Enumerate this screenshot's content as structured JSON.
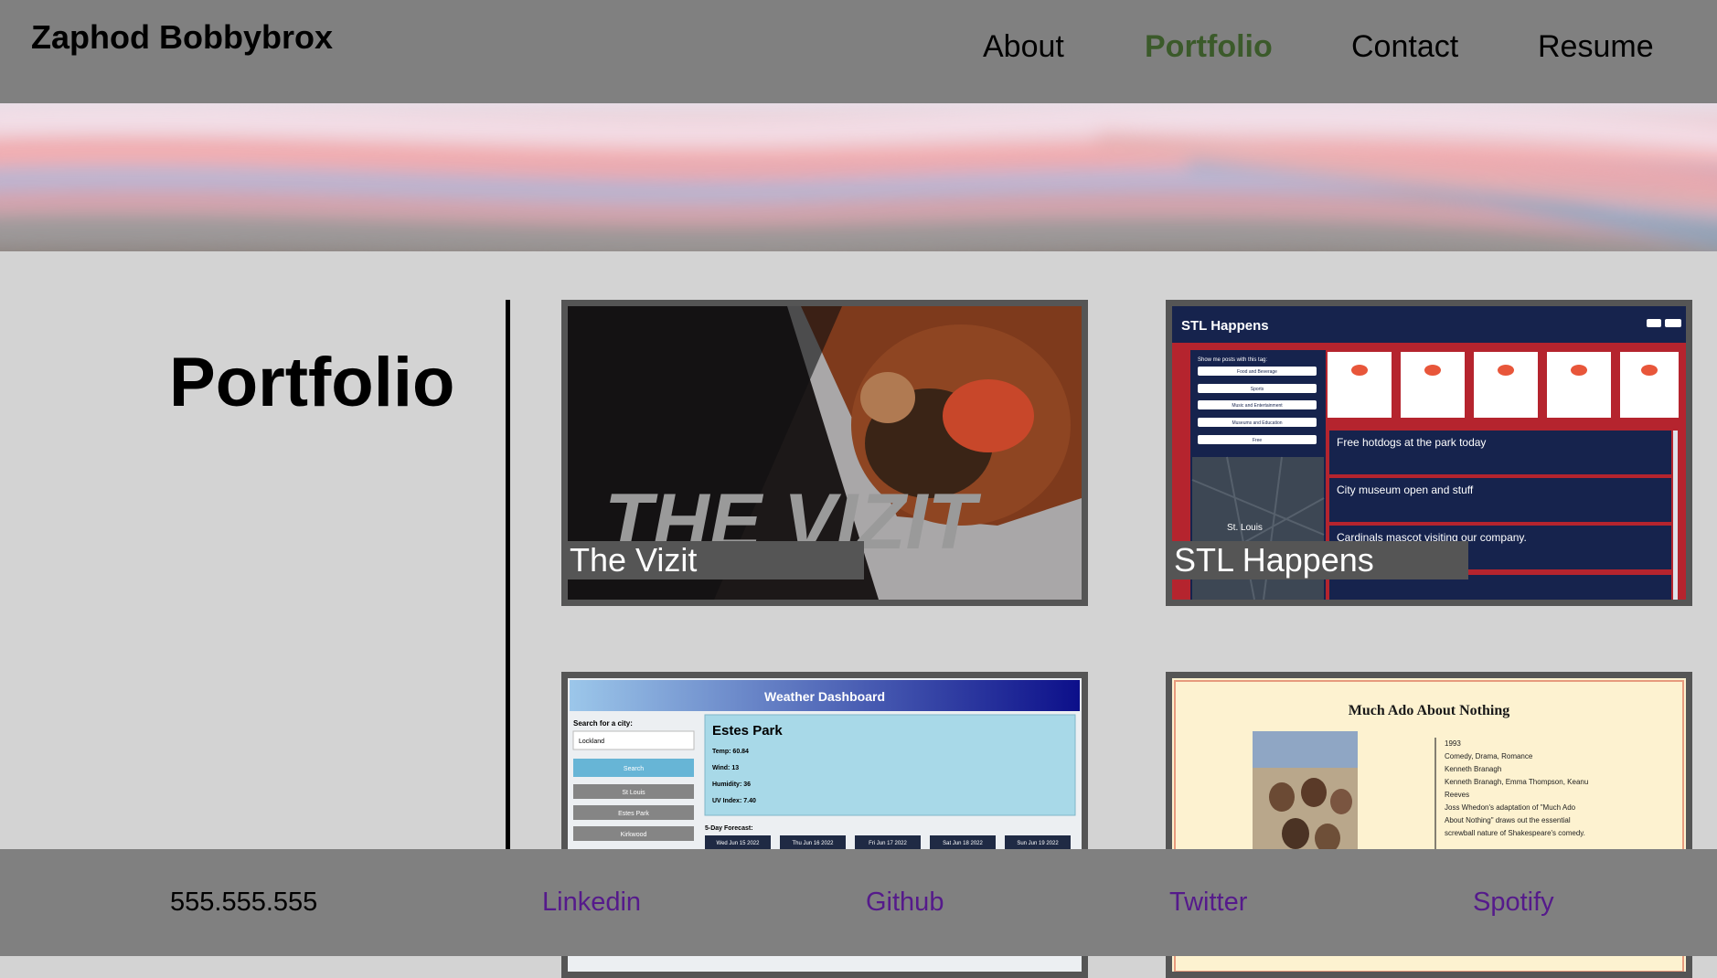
{
  "header": {
    "brand": "Zaphod Bobbybrox",
    "nav": [
      {
        "label": "About"
      },
      {
        "label": "Portfolio",
        "active": true
      },
      {
        "label": "Contact"
      },
      {
        "label": "Resume"
      }
    ]
  },
  "main": {
    "title": "Portfolio",
    "projects": [
      {
        "label": "The Vizit",
        "thumb_text": "THE VIZIT"
      },
      {
        "label": "STL Happens",
        "thumb": {
          "app_title": "STL Happens",
          "tag_prompt": "Show me posts with this tag:",
          "tags": [
            "Food and Beverage",
            "Sports",
            "Music and Entertainment",
            "Museums and Education",
            "Free"
          ],
          "map_city": "St. Louis",
          "posts": [
            "Free hotdogs at the park today",
            "City museum open and stuff",
            "Cardinals mascot visiting our company."
          ]
        }
      },
      {
        "label": "",
        "thumb": {
          "app_title": "Weather Dashboard",
          "search_label": "Search for a city:",
          "search_value": "Lockland",
          "search_button": "Search",
          "history": [
            "St Louis",
            "Estes Park",
            "Kirkwood"
          ],
          "city": "Estes Park",
          "stats": [
            "Temp: 60.84",
            "Wind: 13",
            "Humidity: 36",
            "UV Index: 7.40"
          ],
          "forecast_label": "5-Day Forecast:",
          "forecast": [
            "Wed Jun 15 2022",
            "Thu Jun 16 2022",
            "Fri Jun 17 2022",
            "Sat Jun 18 2022",
            "Sun Jun 19 2022"
          ]
        }
      },
      {
        "label": "",
        "thumb": {
          "app_title": "Much Ado About Nothing",
          "details": [
            "1993",
            "Comedy, Drama, Romance",
            "Kenneth Branagh",
            "Kenneth Branagh, Emma Thompson, Keanu",
            "Reeves",
            "Joss Whedon's adaptation of \"Much Ado",
            "About Nothing\" draws out the essential",
            "screwball nature of Shakespeare's comedy."
          ]
        }
      }
    ]
  },
  "footer": {
    "phone": "555.555.555",
    "links": [
      "Linkedin",
      "Github",
      "Twitter",
      "Spotify"
    ]
  },
  "colors": {
    "header_bg": "#808080",
    "page_bg": "#d3d3d3",
    "active_nav": "#3b5a2a",
    "footer_link": "#551a8b"
  }
}
